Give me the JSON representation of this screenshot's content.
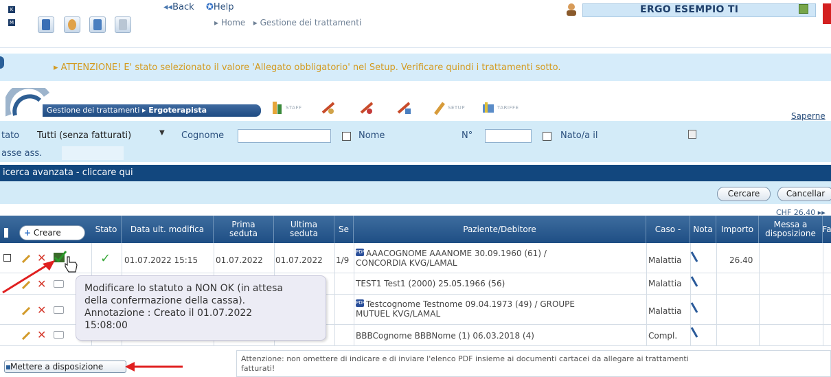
{
  "toolbar": {
    "back_label": "Back",
    "help_label": "Help"
  },
  "breadcrumb": {
    "home": "Home",
    "current": "Gestione dei trattamenti"
  },
  "user": {
    "name": "ERGO ESEMPIO TI"
  },
  "warning": {
    "text": "ATTENZIONE! E' stato selezionato il valore 'Allegato obbligatorio' nel Setup. Verificare quindi i trattamenti sotto."
  },
  "module": {
    "tab_label": "Gestione dei trattamenti",
    "tab_sub": "Ergoterapista",
    "icons": {
      "staff": "STAFF",
      "setup": "SETUP",
      "tariffe": "TARIFFE"
    },
    "help_link": "Saperne d"
  },
  "filters": {
    "stato_label": "tato",
    "stato_value": "Tutti (senza fatturati)",
    "cognome_label": "Cognome",
    "nome_label": "Nome",
    "numero_label": "N°",
    "nato_label": "Nato/a il",
    "cassa_label": "asse ass."
  },
  "advanced_search": "icerca avanzata - cliccare qui",
  "buttons": {
    "cercare": "Cercare",
    "cancellare": "Cancellar"
  },
  "pager": "CHF 26.40 ▸▸",
  "table": {
    "create_label": "Creare",
    "headers": {
      "stato": "Stato",
      "data": "Data ult. modifica",
      "prima_1": "Prima",
      "prima_2": "seduta",
      "ultima_1": "Ultima",
      "ultima_2": "seduta",
      "se": "Se",
      "paziente": "Paziente/Debitore",
      "caso": "Caso -",
      "nota": "Nota",
      "importo": "Importo",
      "messa_1": "Messa a",
      "messa_2": "disposizione",
      "fa": "Fa"
    },
    "rows": [
      {
        "data": "01.07.2022 15:15",
        "prima": "01.07.2022",
        "ultima": "01.07.2022",
        "se": "1/9",
        "paziente_1": "AAACOGNOME AAANOME 30.09.1960 (61) /",
        "paziente_2": "CONCORDIA KVG/LAMAL",
        "caso": "Malattia",
        "importo": "26.40"
      },
      {
        "paziente_1": "TEST1 Test1 (2000) 25.05.1966 (56)",
        "caso": "Malattia"
      },
      {
        "paziente_1": "Testcognome Testnome 09.04.1973 (49) / GROUPE",
        "paziente_2": "MUTUEL KVG/LAMAL",
        "caso": "Malattia"
      },
      {
        "paziente_1": "BBBCognome BBBNome (1) 06.03.2018 (4)",
        "caso": "Compl."
      }
    ]
  },
  "tooltip": {
    "line1": "Modificare lo statuto a NON OK (in attesa",
    "line2": "della confermazione della cassa).",
    "line3": "Annotazione : Creato il 01.07.2022",
    "line4": "15:08:00"
  },
  "bottom": {
    "mettere_label": "Mettere a disposizione",
    "note_1": "Attenzione: non omettere di indicare e di inviare l'elenco PDF insieme ai documenti cartacei da allegare ai trattamenti",
    "note_2": "fatturati!"
  },
  "colors": {
    "navy": "#12477e",
    "light_blue": "#d3ebf8",
    "warning_text": "#d39a1f",
    "arrow_red": "#e02020"
  },
  "icons": [
    "close-icon",
    "patient-icon",
    "wave-icon",
    "document-icon",
    "user-icon",
    "logout-icon",
    "pencil-icon",
    "delete-icon",
    "status-icon",
    "hand-cursor-icon",
    "calendar-icon",
    "note-icon",
    "pdf-icon"
  ]
}
